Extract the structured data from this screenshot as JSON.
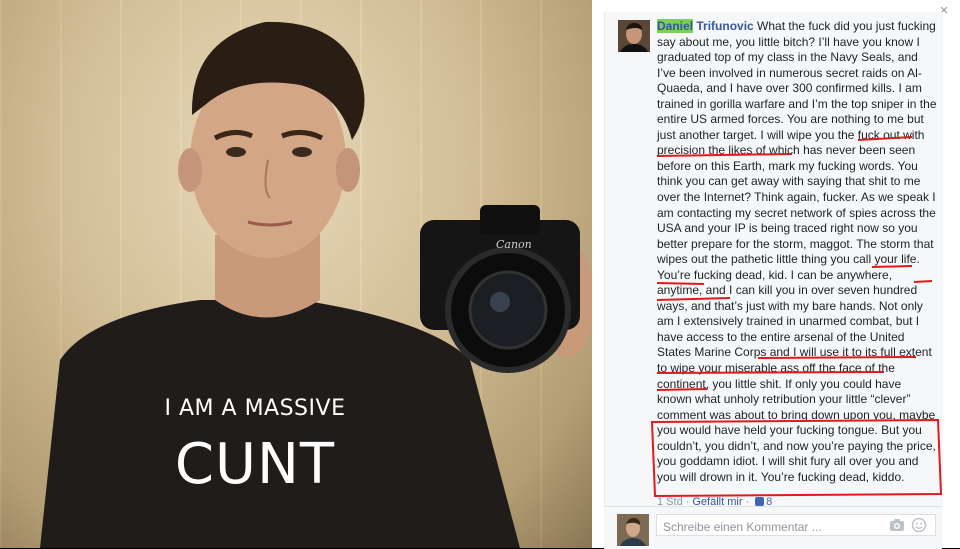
{
  "photo": {
    "caption_line1": "I AM A MASSIVE",
    "caption_line2": "CUNT",
    "camera_brand": "Canon"
  },
  "panel": {
    "close_label": "×",
    "comment": {
      "author_first": "Daniel",
      "author_last": "Trifunovic",
      "body": "What the fuck did you just fucking say about me, you little bitch? I’ll have you know I graduated top of my class in the Navy Seals, and I’ve been involved in numerous secret raids on Al-Quaeda, and I have over 300 confirmed kills. I am trained in gorilla warfare and I’m the top sniper in the entire US armed forces. You are nothing to me but just another target. I will wipe you the fuck out with precision the likes of which has never been seen before on this Earth, mark my fucking words. You think you can get away with saying that shit to me over the Internet? Think again, fucker. As we speak I am contacting my secret network of spies across the USA and your IP is being traced right now so you better prepare for the storm, maggot. The storm that wipes out the pathetic little thing you call your life. You’re fucking dead, kid. I can be anywhere, anytime, and I can kill you in over seven hundred ways, and that’s just with my bare hands. Not only am I extensively trained in unarmed combat, but I have access to the entire arsenal of the United States Marine Corps and I will use it to its full extent to wipe your miserable ass off the face of the continent, you little shit. If only you could have known what unholy retribution your little “clever” comment was about to bring down upon you, maybe you would have held your fucking tongue. But you couldn’t, you didn’t, and now you’re paying the price, you goddamn idiot. I will shit fury all over you and you will drown in it. You’re fucking dead, kiddo.",
      "time": "1 Std",
      "like_label": "Gefällt mir",
      "like_count": "8"
    },
    "reply": {
      "placeholder": "Schreibe einen Kommentar ..."
    }
  },
  "colors": {
    "annotation_red": "#e01b1b",
    "link_blue": "#365899",
    "highlight_green": "#7bd05a"
  }
}
